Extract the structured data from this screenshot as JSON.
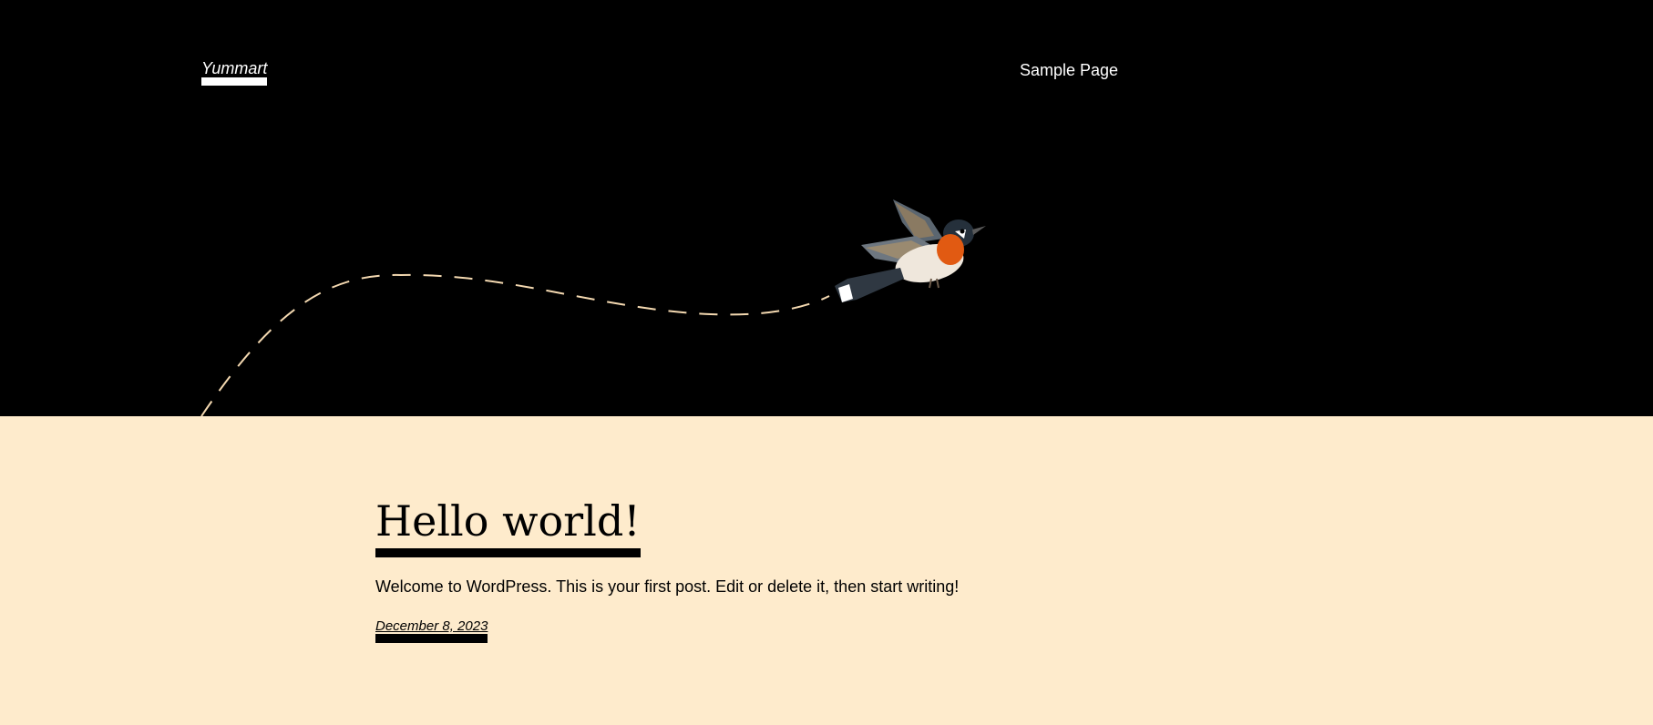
{
  "header": {
    "site_title": "Yummart",
    "nav": [
      {
        "label": "Sample Page"
      }
    ]
  },
  "post": {
    "title": "Hello world!",
    "excerpt": "Welcome to WordPress. This is your first post. Edit or delete it, then start writing!",
    "date": "December 8, 2023"
  },
  "colors": {
    "header_bg": "#000000",
    "content_bg": "#feebcc",
    "dash": "#f3d8b0"
  },
  "icons": [
    "bird-illustration"
  ]
}
